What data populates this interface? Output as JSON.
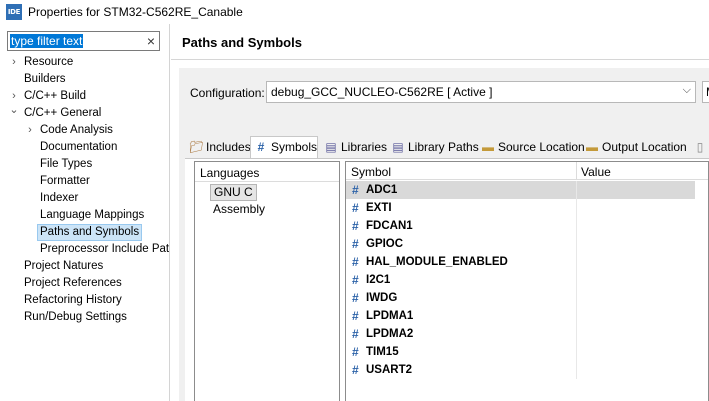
{
  "window": {
    "app_icon": "IDE",
    "title": "Properties for STM32-C562RE_Canable"
  },
  "filter": {
    "value": "type filter text",
    "clear_icon": "×"
  },
  "tree": {
    "items": [
      {
        "label": "Resource",
        "twisty": "›"
      },
      {
        "label": "Builders",
        "twisty": ""
      },
      {
        "label": "C/C++ Build",
        "twisty": "›"
      },
      {
        "label": "C/C++ General",
        "twisty": "⌄"
      },
      {
        "label": "Code Analysis",
        "twisty": "›"
      },
      {
        "label": "Documentation",
        "twisty": ""
      },
      {
        "label": "File Types",
        "twisty": ""
      },
      {
        "label": "Formatter",
        "twisty": ""
      },
      {
        "label": "Indexer",
        "twisty": ""
      },
      {
        "label": "Language Mappings",
        "twisty": ""
      },
      {
        "label": "Paths and Symbols",
        "twisty": ""
      },
      {
        "label": "Preprocessor Include Pat",
        "twisty": ""
      },
      {
        "label": "Project Natures",
        "twisty": ""
      },
      {
        "label": "Project References",
        "twisty": ""
      },
      {
        "label": "Refactoring History",
        "twisty": ""
      },
      {
        "label": "Run/Debug Settings",
        "twisty": ""
      }
    ]
  },
  "page": {
    "title": "Paths and Symbols"
  },
  "configuration": {
    "label": "Configuration:",
    "value": "debug_GCC_NUCLEO-C562RE  [ Active ]",
    "arrow": "⌵",
    "manage_label": "M"
  },
  "tabs": [
    {
      "label": "Includes",
      "icon": "include-icon"
    },
    {
      "label": "Symbols",
      "icon": "hash-icon"
    },
    {
      "label": "Libraries",
      "icon": "library-icon"
    },
    {
      "label": "Library Paths",
      "icon": "library-path-icon"
    },
    {
      "label": "Source Location",
      "icon": "folder-icon"
    },
    {
      "label": "Output Location",
      "icon": "folder-icon"
    },
    {
      "label": "",
      "icon": "document-icon"
    }
  ],
  "languages": {
    "header": "Languages",
    "items": [
      "GNU C",
      "Assembly"
    ]
  },
  "symbols": {
    "col_symbol": "Symbol",
    "col_value": "Value",
    "hash": "#",
    "rows": [
      {
        "name": "ADC1",
        "value": ""
      },
      {
        "name": "EXTI",
        "value": ""
      },
      {
        "name": "FDCAN1",
        "value": ""
      },
      {
        "name": "GPIOC",
        "value": ""
      },
      {
        "name": "HAL_MODULE_ENABLED",
        "value": ""
      },
      {
        "name": "I2C1",
        "value": ""
      },
      {
        "name": "IWDG",
        "value": ""
      },
      {
        "name": "LPDMA1",
        "value": ""
      },
      {
        "name": "LPDMA2",
        "value": ""
      },
      {
        "name": "TIM15",
        "value": ""
      },
      {
        "name": "USART2",
        "value": ""
      }
    ]
  }
}
